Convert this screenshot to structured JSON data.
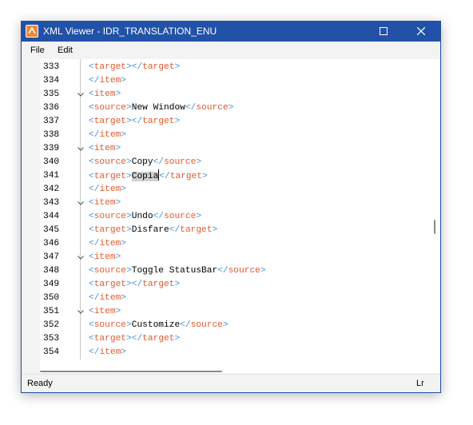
{
  "window": {
    "title": "XML Viewer - IDR_TRANSLATION_ENU"
  },
  "menu": {
    "file": "File",
    "edit": "Edit"
  },
  "code_lines": [
    {
      "num": "333",
      "fold": false,
      "parts": [
        [
          "br",
          "<"
        ],
        [
          "tg",
          "target"
        ],
        [
          "br",
          "></"
        ],
        [
          "tg",
          "target"
        ],
        [
          "br",
          ">"
        ]
      ]
    },
    {
      "num": "334",
      "fold": false,
      "parts": [
        [
          "br",
          "</"
        ],
        [
          "tg",
          "item"
        ],
        [
          "br",
          ">"
        ]
      ]
    },
    {
      "num": "335",
      "fold": true,
      "parts": [
        [
          "br",
          "<"
        ],
        [
          "tg",
          "item"
        ],
        [
          "br",
          ">"
        ]
      ]
    },
    {
      "num": "336",
      "fold": false,
      "parts": [
        [
          "br",
          "<"
        ],
        [
          "tg",
          "source"
        ],
        [
          "br",
          ">"
        ],
        [
          "tx",
          "New Window"
        ],
        [
          "br",
          "</"
        ],
        [
          "tg",
          "source"
        ],
        [
          "br",
          ">"
        ]
      ]
    },
    {
      "num": "337",
      "fold": false,
      "parts": [
        [
          "br",
          "<"
        ],
        [
          "tg",
          "target"
        ],
        [
          "br",
          "></"
        ],
        [
          "tg",
          "target"
        ],
        [
          "br",
          ">"
        ]
      ]
    },
    {
      "num": "338",
      "fold": false,
      "parts": [
        [
          "br",
          "</"
        ],
        [
          "tg",
          "item"
        ],
        [
          "br",
          ">"
        ]
      ]
    },
    {
      "num": "339",
      "fold": true,
      "parts": [
        [
          "br",
          "<"
        ],
        [
          "tg",
          "item"
        ],
        [
          "br",
          ">"
        ]
      ]
    },
    {
      "num": "340",
      "fold": false,
      "parts": [
        [
          "br",
          "<"
        ],
        [
          "tg",
          "source"
        ],
        [
          "br",
          ">"
        ],
        [
          "tx",
          "Copy"
        ],
        [
          "br",
          "</"
        ],
        [
          "tg",
          "source"
        ],
        [
          "br",
          ">"
        ]
      ]
    },
    {
      "num": "341",
      "fold": false,
      "parts": [
        [
          "br",
          "<"
        ],
        [
          "tg",
          "target"
        ],
        [
          "br",
          ">"
        ],
        [
          "sel",
          "Copia"
        ],
        [
          "caret",
          ""
        ],
        [
          "br",
          "</"
        ],
        [
          "tg",
          "target"
        ],
        [
          "br",
          ">"
        ]
      ]
    },
    {
      "num": "342",
      "fold": false,
      "parts": [
        [
          "br",
          "</"
        ],
        [
          "tg",
          "item"
        ],
        [
          "br",
          ">"
        ]
      ]
    },
    {
      "num": "343",
      "fold": true,
      "parts": [
        [
          "br",
          "<"
        ],
        [
          "tg",
          "item"
        ],
        [
          "br",
          ">"
        ]
      ]
    },
    {
      "num": "344",
      "fold": false,
      "parts": [
        [
          "br",
          "<"
        ],
        [
          "tg",
          "source"
        ],
        [
          "br",
          ">"
        ],
        [
          "tx",
          "Undo"
        ],
        [
          "br",
          "</"
        ],
        [
          "tg",
          "source"
        ],
        [
          "br",
          ">"
        ]
      ]
    },
    {
      "num": "345",
      "fold": false,
      "parts": [
        [
          "br",
          "<"
        ],
        [
          "tg",
          "target"
        ],
        [
          "br",
          ">"
        ],
        [
          "tx",
          "Disfare"
        ],
        [
          "br",
          "</"
        ],
        [
          "tg",
          "target"
        ],
        [
          "br",
          ">"
        ]
      ]
    },
    {
      "num": "346",
      "fold": false,
      "parts": [
        [
          "br",
          "</"
        ],
        [
          "tg",
          "item"
        ],
        [
          "br",
          ">"
        ]
      ]
    },
    {
      "num": "347",
      "fold": true,
      "parts": [
        [
          "br",
          "<"
        ],
        [
          "tg",
          "item"
        ],
        [
          "br",
          ">"
        ]
      ]
    },
    {
      "num": "348",
      "fold": false,
      "parts": [
        [
          "br",
          "<"
        ],
        [
          "tg",
          "source"
        ],
        [
          "br",
          ">"
        ],
        [
          "tx",
          "Toggle StatusBar"
        ],
        [
          "br",
          "</"
        ],
        [
          "tg",
          "source"
        ],
        [
          "br",
          ">"
        ]
      ]
    },
    {
      "num": "349",
      "fold": false,
      "parts": [
        [
          "br",
          "<"
        ],
        [
          "tg",
          "target"
        ],
        [
          "br",
          "></"
        ],
        [
          "tg",
          "target"
        ],
        [
          "br",
          ">"
        ]
      ]
    },
    {
      "num": "350",
      "fold": false,
      "parts": [
        [
          "br",
          "</"
        ],
        [
          "tg",
          "item"
        ],
        [
          "br",
          ">"
        ]
      ]
    },
    {
      "num": "351",
      "fold": true,
      "parts": [
        [
          "br",
          "<"
        ],
        [
          "tg",
          "item"
        ],
        [
          "br",
          ">"
        ]
      ]
    },
    {
      "num": "352",
      "fold": false,
      "parts": [
        [
          "br",
          "<"
        ],
        [
          "tg",
          "source"
        ],
        [
          "br",
          ">"
        ],
        [
          "tx",
          "Customize"
        ],
        [
          "br",
          "</"
        ],
        [
          "tg",
          "source"
        ],
        [
          "br",
          ">"
        ]
      ]
    },
    {
      "num": "353",
      "fold": false,
      "parts": [
        [
          "br",
          "<"
        ],
        [
          "tg",
          "target"
        ],
        [
          "br",
          "></"
        ],
        [
          "tg",
          "target"
        ],
        [
          "br",
          ">"
        ]
      ]
    },
    {
      "num": "354",
      "fold": false,
      "parts": [
        [
          "br",
          "</"
        ],
        [
          "tg",
          "item"
        ],
        [
          "br",
          ">"
        ]
      ]
    }
  ],
  "status": {
    "text": "Ready",
    "right": "Lr"
  },
  "colors": {
    "titlebar": "#2152a8",
    "tag": "#e1582e",
    "bracket": "#4a90d6",
    "selection": "#d0d0d0"
  },
  "icons": {
    "app": "app-icon",
    "maximize": "maximize-icon",
    "close": "close-icon",
    "fold": "chevron-down-icon"
  }
}
